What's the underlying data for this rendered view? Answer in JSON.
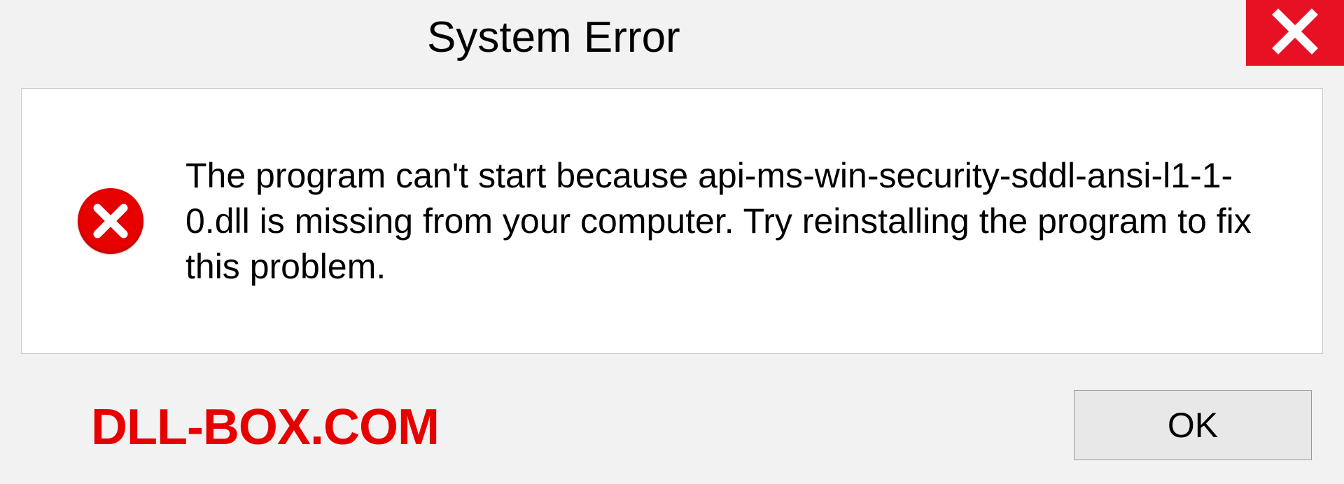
{
  "titlebar": {
    "title": "System Error"
  },
  "dialog": {
    "message": "The program can't start because api-ms-win-security-sddl-ansi-l1-1-0.dll is missing from your computer. Try reinstalling the program to fix this problem."
  },
  "branding": {
    "text": "DLL-BOX.COM"
  },
  "buttons": {
    "ok_label": "OK"
  }
}
